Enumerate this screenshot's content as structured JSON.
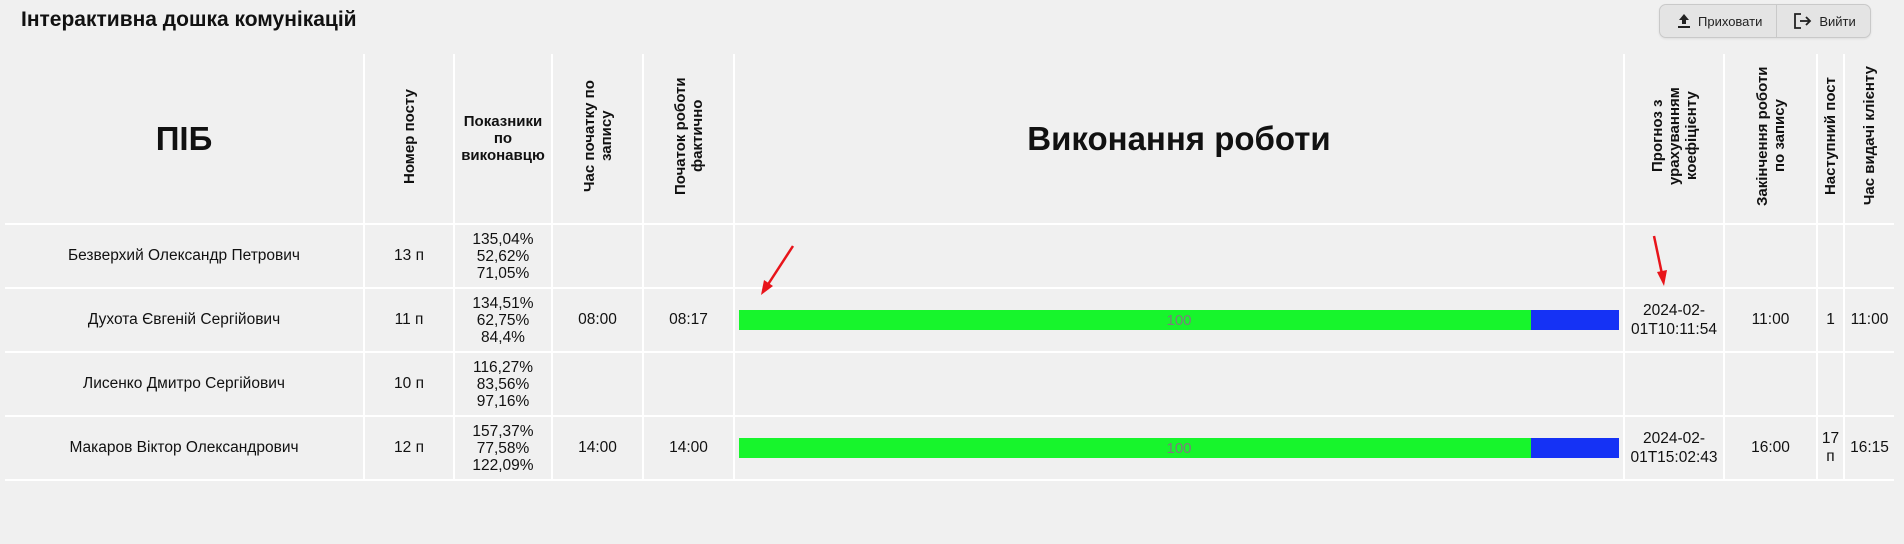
{
  "header": {
    "title": "Інтерактивна дошка комунікацій",
    "hide_label": "Приховати",
    "exit_label": "Вийти"
  },
  "table": {
    "columns": {
      "name": "ПІБ",
      "post": "Номер посту",
      "stats": "Показники по виконавцю",
      "start_planned": "Час початку по запису",
      "start_actual": "Початок роботи фактично",
      "progress": "Виконання роботи",
      "forecast": "Прогноз з урахуванням коефіцієнту",
      "end_planned": "Закінчення роботи по запису",
      "next_post": "Наступний пост",
      "delivery": "Час видачі клієнту"
    },
    "rows": [
      {
        "name": "Безверхий Олександр Петрович",
        "post": "13 п",
        "stats": [
          "135,04%",
          "52,62%",
          "71,05%"
        ],
        "start_planned": "",
        "start_actual": "",
        "progress_label": "",
        "forecast": "",
        "end_planned": "",
        "next_post": "",
        "delivery": ""
      },
      {
        "name": "Духота Євгеній Сергійович",
        "post": "11 п",
        "stats": [
          "134,51%",
          "62,75%",
          "84,4%"
        ],
        "start_planned": "08:00",
        "start_actual": "08:17",
        "progress_label": "100",
        "progress_fraction": 0.9,
        "forecast": "2024-02-01T10:11:54",
        "end_planned": "11:00",
        "next_post": "1",
        "delivery": "11:00"
      },
      {
        "name": "Лисенко Дмитро Сергійович",
        "post": "10 п",
        "stats": [
          "116,27%",
          "83,56%",
          "97,16%"
        ],
        "start_planned": "",
        "start_actual": "",
        "progress_label": "",
        "forecast": "",
        "end_planned": "",
        "next_post": "",
        "delivery": ""
      },
      {
        "name": "Макаров Віктор Олександрович",
        "post": "12 п",
        "stats": [
          "157,37%",
          "77,58%",
          "122,09%"
        ],
        "start_planned": "14:00",
        "start_actual": "14:00",
        "progress_label": "100",
        "progress_fraction": 0.9,
        "forecast": "2024-02-01T15:02:43",
        "end_planned": "16:00",
        "next_post": "17 п",
        "delivery": "16:15"
      }
    ]
  },
  "colors": {
    "progress_done": "#17f52c",
    "progress_over": "#1532f5",
    "annotation_arrow": "#e8141a"
  },
  "icons": {
    "hide": "upload-icon",
    "exit": "logout-icon"
  }
}
